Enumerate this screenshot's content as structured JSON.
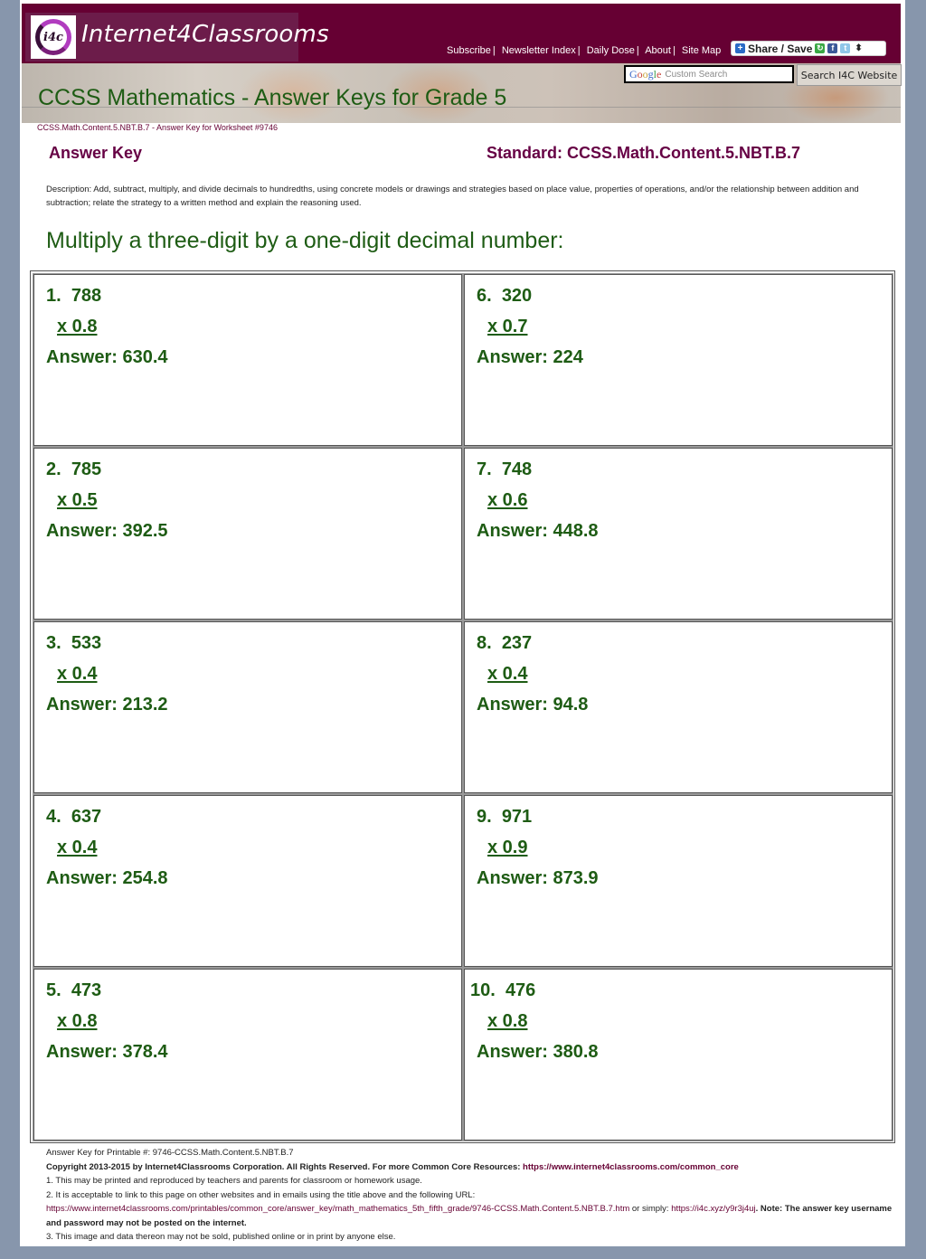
{
  "header": {
    "logo_mark": "i4c",
    "logo_text": "Internet4Classrooms",
    "nav": [
      {
        "label": "Subscribe"
      },
      {
        "label": "Newsletter Index"
      },
      {
        "label": "Daily Dose"
      },
      {
        "label": "About"
      },
      {
        "label": "Site Map"
      }
    ],
    "share_label": "Share / Save",
    "share_icons": [
      "plus-icon",
      "google-icon",
      "facebook-icon",
      "twitter-icon",
      "updown-arrows-icon"
    ],
    "search": {
      "brand": "Google",
      "placeholder": "Custom Search",
      "button_label": "Search I4C Website"
    }
  },
  "page_title": "CCSS Mathematics - Answer Keys for Grade 5",
  "breadcrumb": "CCSS.Math.Content.5.NBT.B.7 - Answer Key for Worksheet #9746",
  "answer_key_heading": "Answer Key",
  "standard_heading": "Standard: CCSS.Math.Content.5.NBT.B.7",
  "description": "Description: Add, subtract, multiply, and divide decimals to hundredths, using concrete models or drawings and strategies based on place value, properties of operations, and/or the relationship between addition and subtraction; relate the strategy to a written method and explain the reasoning used.",
  "section_title": "Multiply a three-digit by a one-digit decimal number:",
  "problems": [
    {
      "number": "1.",
      "multiplicand": "788",
      "multiplier": "x 0.8",
      "answer": "Answer: 630.4"
    },
    {
      "number": "2.",
      "multiplicand": "785",
      "multiplier": "x 0.5",
      "answer": "Answer: 392.5"
    },
    {
      "number": "3.",
      "multiplicand": "533",
      "multiplier": "x 0.4",
      "answer": "Answer: 213.2"
    },
    {
      "number": "4.",
      "multiplicand": "637",
      "multiplier": "x 0.4",
      "answer": "Answer: 254.8"
    },
    {
      "number": "5.",
      "multiplicand": "473",
      "multiplier": "x 0.8",
      "answer": "Answer: 378.4"
    },
    {
      "number": "6.",
      "multiplicand": "320",
      "multiplier": "x 0.7",
      "answer": "Answer: 224"
    },
    {
      "number": "7.",
      "multiplicand": "748",
      "multiplier": "x 0.6",
      "answer": "Answer: 448.8"
    },
    {
      "number": "8.",
      "multiplicand": "237",
      "multiplier": "x 0.4",
      "answer": "Answer: 94.8"
    },
    {
      "number": "9.",
      "multiplicand": "971",
      "multiplier": "x 0.9",
      "answer": "Answer: 873.9"
    },
    {
      "number": "10.",
      "multiplicand": "476",
      "multiplier": "x 0.8",
      "answer": "Answer: 380.8"
    }
  ],
  "footer": {
    "printable": "Answer Key for Printable #: 9746-CCSS.Math.Content.5.NBT.B.7",
    "copyright": "Copyright 2013-2015 by Internet4Classrooms Corporation. All Rights Reserved. For more Common Core Resources:",
    "copyright_link": "https://www.internet4classrooms.com/common_core",
    "note1": "1. This may be printed and reproduced by teachers and parents for classroom or homework usage.",
    "note2": "2. It is acceptable to link to this page on other websites and in emails using the title above and the following URL:",
    "url_long": "https://www.internet4classrooms.com/printables/common_core/answer_key/math_mathematics_5th_fifth_grade/9746-CCSS.Math.Content.5.NBT.B.7.htm",
    "or_simply": " or simply: ",
    "url_short": "https://i4c.xyz/y9r3j4uj",
    "note_bold": ". Note: The answer key username and password may not be posted on the internet.",
    "note3": "3. This image and data thereon may not be sold, published online or in print by anyone else."
  },
  "colors": {
    "brand": "#660033",
    "heading_purple": "#660044",
    "answer_green": "#1e5c14",
    "page_bg": "#8796ac"
  }
}
